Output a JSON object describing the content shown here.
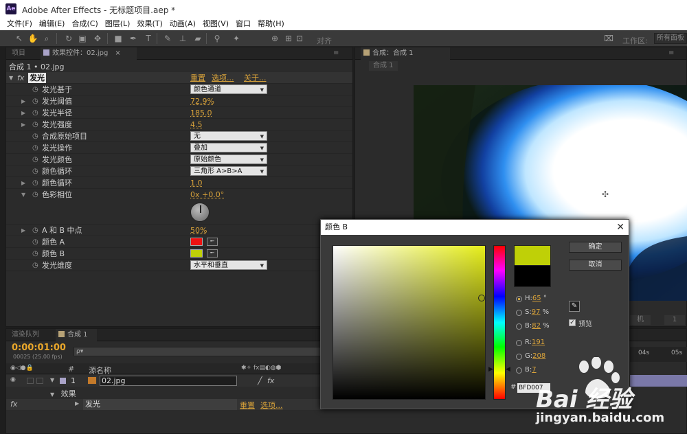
{
  "titlebar": {
    "logo": "Ae",
    "title": "Adobe After Effects - 无标题项目.aep *"
  },
  "menu": [
    "文件(F)",
    "编辑(E)",
    "合成(C)",
    "图层(L)",
    "效果(T)",
    "动画(A)",
    "视图(V)",
    "窗口",
    "帮助(H)"
  ],
  "toolbar": {
    "align_label": "对齐",
    "workspace_label": "工作区:",
    "workspace_value": "所有面板"
  },
  "effects_panel": {
    "tabs": [
      "项目",
      "效果控件：02.jpg"
    ],
    "breadcrumb": "合成 1 • 02.jpg",
    "fx_label": "fx",
    "effect_name": "发光",
    "reset": "重置",
    "options": "选项...",
    "about": "关于...",
    "props": [
      {
        "label": "发光基于",
        "type": "dropdown",
        "value": "颜色通道",
        "twirl": false
      },
      {
        "label": "发光阈值",
        "type": "value",
        "value": "72.9%",
        "twirl": true
      },
      {
        "label": "发光半径",
        "type": "value",
        "value": "185.0",
        "twirl": true
      },
      {
        "label": "发光强度",
        "type": "value",
        "value": "4.5",
        "twirl": true
      },
      {
        "label": "合成原始项目",
        "type": "dropdown",
        "value": "无",
        "twirl": false
      },
      {
        "label": "发光操作",
        "type": "dropdown",
        "value": "叠加",
        "twirl": false
      },
      {
        "label": "发光颜色",
        "type": "dropdown",
        "value": "原始颜色",
        "twirl": false
      },
      {
        "label": "颜色循环",
        "type": "dropdown",
        "value": "三角形 A>B>A",
        "twirl": false
      },
      {
        "label": "颜色循环",
        "type": "value",
        "value": "1.0",
        "twirl": true
      },
      {
        "label": "色彩相位",
        "type": "dial",
        "value": "0x +0.0°",
        "twirl": true
      },
      {
        "label": "A 和 B 中点",
        "type": "value",
        "value": "50%",
        "twirl": true
      },
      {
        "label": "颜色 A",
        "type": "color",
        "value": "#ee1111",
        "twirl": false
      },
      {
        "label": "颜色 B",
        "type": "color",
        "value": "#bfd007",
        "twirl": false
      },
      {
        "label": "发光维度",
        "type": "dropdown",
        "value": "水平和垂直",
        "twirl": false
      }
    ]
  },
  "comp_panel": {
    "tab": "合成：合成 1",
    "subtab": "合成 1",
    "view_label": "机",
    "view_num": "1"
  },
  "timeline": {
    "tabs": [
      "渲染队列",
      "合成 1"
    ],
    "timecode": "0:00:01:00",
    "fps": "00025 (25.00 fps)",
    "search_glyph": "ρ▾",
    "col_hash": "#",
    "col_source": "源名称",
    "layer_index": "1",
    "layer_name": "02.jpg",
    "effects_group": "效果",
    "fx_label": "fx",
    "effect_name": "发光",
    "reset": "重置",
    "options": "选项...",
    "ruler": [
      "04s",
      "05s"
    ]
  },
  "color_dialog": {
    "title": "颜色 B",
    "ok": "确定",
    "cancel": "取消",
    "preview": "预览",
    "new_color": "#bfd007",
    "old_color": "#000000",
    "fields": [
      {
        "label": "H:",
        "value": "65",
        "unit": "°",
        "selected": true
      },
      {
        "label": "S:",
        "value": "97",
        "unit": "%",
        "selected": false
      },
      {
        "label": "B:",
        "value": "82",
        "unit": "%",
        "selected": false
      },
      {
        "label": "R:",
        "value": "191",
        "unit": "",
        "selected": false
      },
      {
        "label": "G:",
        "value": "208",
        "unit": "",
        "selected": false
      },
      {
        "label": "B:",
        "value": "7",
        "unit": "",
        "selected": false
      }
    ],
    "hex_prefix": "#",
    "hex": "BFD007"
  },
  "watermark": {
    "brand": "Bai 经验",
    "url": "jingyan.baidu.com"
  }
}
